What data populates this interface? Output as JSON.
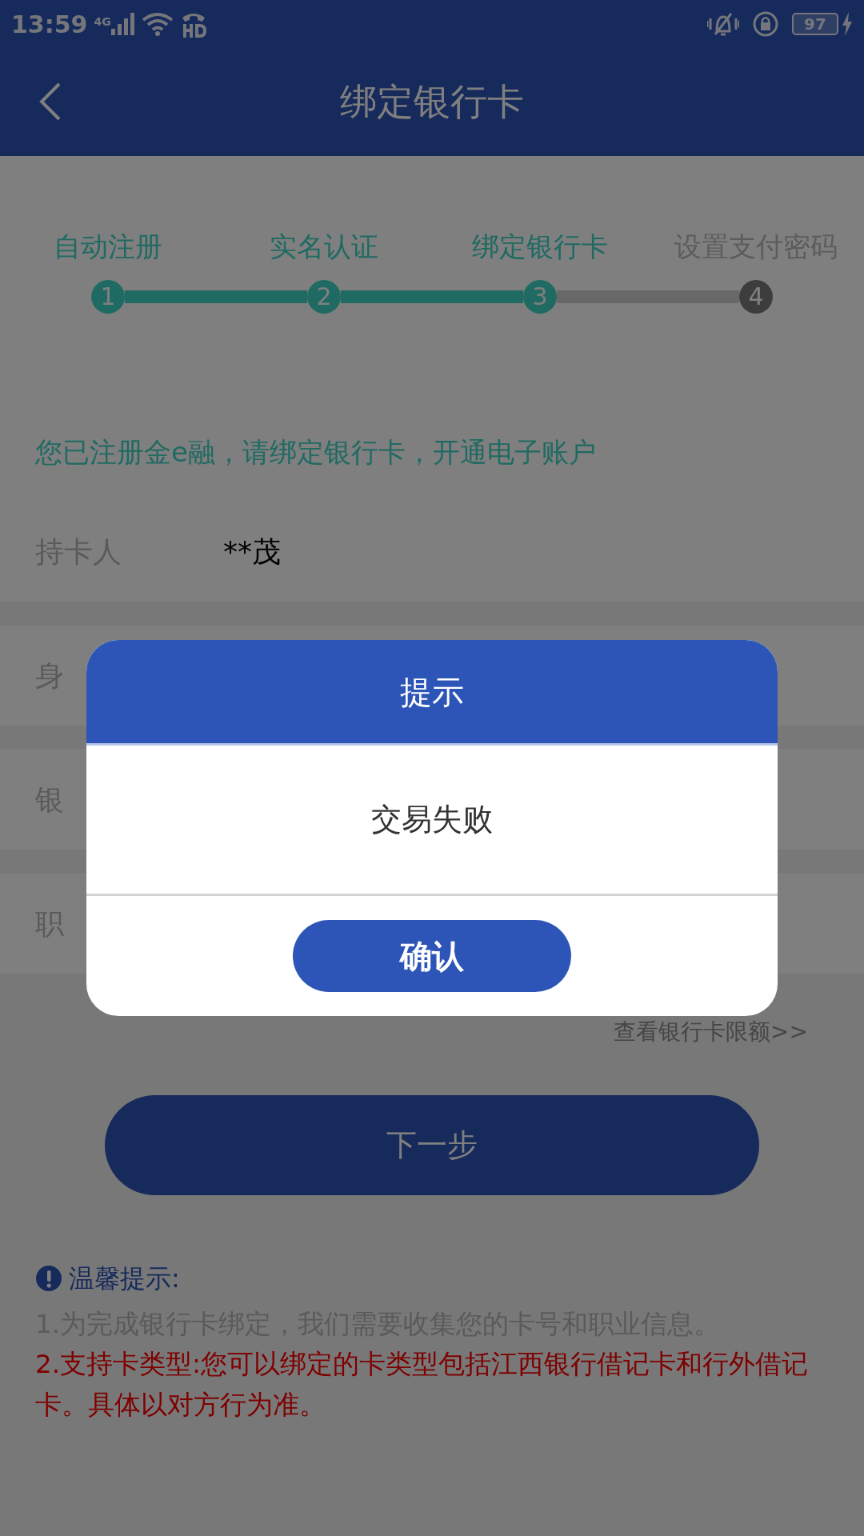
{
  "status_bar": {
    "time": "13:59",
    "network": "4G",
    "battery": "97"
  },
  "header": {
    "title": "绑定银行卡"
  },
  "steps": [
    {
      "label": "自动注册",
      "number": "1",
      "done": true
    },
    {
      "label": "实名认证",
      "number": "2",
      "done": true
    },
    {
      "label": "绑定银行卡",
      "number": "3",
      "done": true
    },
    {
      "label": "设置支付密码",
      "number": "4",
      "done": false
    }
  ],
  "notice": "您已注册金e融，请绑定银行卡，开通电子账户",
  "fields": [
    {
      "label": "持卡人",
      "value": "**茂"
    },
    {
      "label": "身"
    },
    {
      "label": "银"
    },
    {
      "label": "职"
    }
  ],
  "limit_link": "查看银行卡限额>>",
  "next_button": "下一步",
  "tips": {
    "title": "温馨提示:",
    "lines": [
      {
        "text": "1.为完成银行卡绑定，我们需要收集您的卡号和职业信息。",
        "important": false
      },
      {
        "text": "2.支持卡类型:您可以绑定的卡类型包括江西银行借记卡和行外借记卡。具体以对方行为准。",
        "important": true
      }
    ]
  },
  "dialog": {
    "title": "提示",
    "message": "交易失败",
    "button": "确认"
  }
}
